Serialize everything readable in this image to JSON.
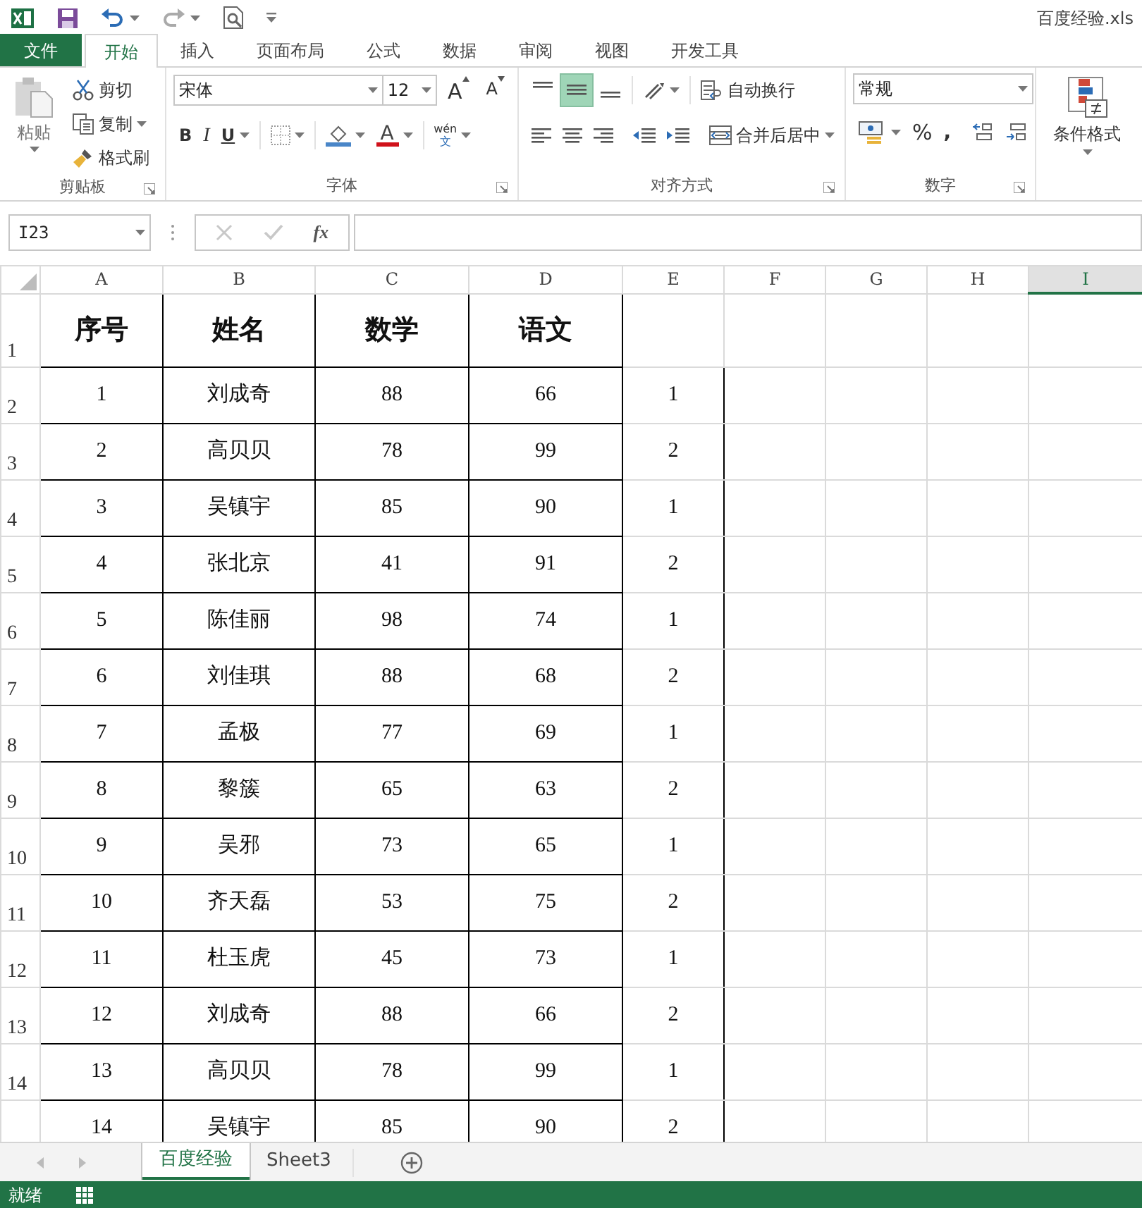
{
  "title_bar": {
    "filename": "百度经验.xls"
  },
  "ribbon_tabs": [
    {
      "label": "文件",
      "kind": "file",
      "selected": false
    },
    {
      "label": "开始",
      "kind": "tab",
      "selected": true
    },
    {
      "label": "插入",
      "kind": "tab",
      "selected": false
    },
    {
      "label": "页面布局",
      "kind": "tab",
      "selected": false
    },
    {
      "label": "公式",
      "kind": "tab",
      "selected": false
    },
    {
      "label": "数据",
      "kind": "tab",
      "selected": false
    },
    {
      "label": "审阅",
      "kind": "tab",
      "selected": false
    },
    {
      "label": "视图",
      "kind": "tab",
      "selected": false
    },
    {
      "label": "开发工具",
      "kind": "tab",
      "selected": false
    }
  ],
  "clipboard": {
    "paste": "粘贴",
    "cut": "剪切",
    "copy": "复制",
    "format_painter": "格式刷",
    "group": "剪贴板"
  },
  "font": {
    "name": "宋体",
    "size": "12",
    "grow": "A",
    "shrink": "A",
    "bold": "B",
    "italic": "I",
    "underline": "U",
    "font_color": "A",
    "phonetic_top": "wén",
    "phonetic_bottom": "文",
    "group": "字体"
  },
  "alignment": {
    "vertical": [
      {
        "selected": false
      },
      {
        "selected": true
      },
      {
        "selected": false
      }
    ],
    "wrap": "自动换行",
    "merge": "合并后居中",
    "group": "对齐方式"
  },
  "number": {
    "format": "常规",
    "percent": "%",
    "comma": ",",
    "group": "数字"
  },
  "styles": {
    "conditional": "条件格式"
  },
  "formula_bar": {
    "name_box": "I23",
    "fx": "fx"
  },
  "columns": [
    {
      "label": "A",
      "selected": false
    },
    {
      "label": "B",
      "selected": false
    },
    {
      "label": "C",
      "selected": false
    },
    {
      "label": "D",
      "selected": false
    },
    {
      "label": "E",
      "selected": false
    },
    {
      "label": "F",
      "selected": false
    },
    {
      "label": "G",
      "selected": false
    },
    {
      "label": "H",
      "selected": false
    },
    {
      "label": "I",
      "selected": true
    }
  ],
  "rows": [
    {
      "number": "1",
      "cells": [
        "序号",
        "姓名",
        "数学",
        "语文"
      ]
    },
    {
      "number": "2",
      "cells": [
        "1",
        "刘成奇",
        "88",
        "66",
        "1"
      ]
    },
    {
      "number": "3",
      "cells": [
        "2",
        "高贝贝",
        "78",
        "99",
        "2"
      ]
    },
    {
      "number": "4",
      "cells": [
        "3",
        "吴镇宇",
        "85",
        "90",
        "1"
      ]
    },
    {
      "number": "5",
      "cells": [
        "4",
        "张北京",
        "41",
        "91",
        "2"
      ]
    },
    {
      "number": "6",
      "cells": [
        "5",
        "陈佳丽",
        "98",
        "74",
        "1"
      ]
    },
    {
      "number": "7",
      "cells": [
        "6",
        "刘佳琪",
        "88",
        "68",
        "2"
      ]
    },
    {
      "number": "8",
      "cells": [
        "7",
        "孟极",
        "77",
        "69",
        "1"
      ]
    },
    {
      "number": "9",
      "cells": [
        "8",
        "黎簇",
        "65",
        "63",
        "2"
      ]
    },
    {
      "number": "10",
      "cells": [
        "9",
        "吴邪",
        "73",
        "65",
        "1"
      ]
    },
    {
      "number": "11",
      "cells": [
        "10",
        "齐天磊",
        "53",
        "75",
        "2"
      ]
    },
    {
      "number": "12",
      "cells": [
        "11",
        "杜玉虎",
        "45",
        "73",
        "1"
      ]
    },
    {
      "number": "13",
      "cells": [
        "12",
        "刘成奇",
        "88",
        "66",
        "2"
      ]
    },
    {
      "number": "14",
      "cells": [
        "13",
        "高贝贝",
        "78",
        "99",
        "1"
      ]
    },
    {
      "cells": [
        "14",
        "吴镇宇",
        "85",
        "90",
        "2"
      ]
    }
  ],
  "sheets": [
    {
      "label": "百度经验",
      "selected": true
    },
    {
      "label": "Sheet3",
      "selected": false
    }
  ],
  "status_bar": {
    "text": "就绪"
  }
}
